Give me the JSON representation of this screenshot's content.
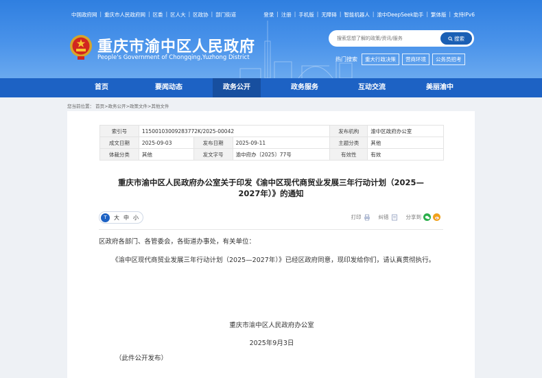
{
  "header": {
    "top_links_left": [
      "中国政府网",
      "重庆市人民政府网",
      "区委",
      "区人大",
      "区政协",
      "部门街道"
    ],
    "top_links_right": [
      "登录",
      "注册",
      "手机版",
      "无障碍",
      "智能机器人",
      "渝中DeepSeek助手",
      "繁体版",
      "支持IPv6"
    ],
    "site_title": "重庆市渝中区人民政府",
    "site_subtitle": "People's Government of Chongqing,Yuzhong District",
    "search": {
      "placeholder": "搜索您想了解的政策/资讯/服务",
      "button_label": "搜索"
    },
    "hot_label": "热门搜索",
    "hot_tags": [
      "重大行政决策",
      "营商环境",
      "公务员招考"
    ]
  },
  "nav": {
    "items": [
      "首页",
      "要闻动态",
      "政务公开",
      "政务服务",
      "互动交流",
      "美丽渝中"
    ],
    "active": "政务公开"
  },
  "breadcrumb": "您当前位置： 首页>政务公开>政策文件>其他文件",
  "meta": {
    "rows": [
      [
        "索引号",
        "11500103009283772K/2025-00042",
        "",
        "",
        "发布机构",
        "渝中区政府办公室"
      ],
      [
        "成文日期",
        "2025-09-03",
        "发布日期",
        "2025-09-11",
        "主题分类",
        "其他"
      ],
      [
        "体裁分类",
        "其他",
        "发文字号",
        "渝中府办〔2025〕77号",
        "有效性",
        "有效"
      ]
    ]
  },
  "article": {
    "title_line1": "重庆市渝中区人民政府办公室关于印发《渝中区现代商贸业发展三年行动计划（2025—",
    "title_line2": "2027年）》的通知",
    "font_size": {
      "large": "大",
      "medium": "中",
      "small": "小"
    },
    "tools": {
      "print": "打印",
      "correct": "纠错",
      "share": "分享到"
    },
    "para1": "区政府各部门、各管委会，各街道办事处，有关单位：",
    "para2": "《渝中区现代商贸业发展三年行动计划（2025—2027年）》已经区政府同意，现印发给你们，请认真贯彻执行。",
    "signature": "重庆市渝中区人民政府办公室",
    "date": "2025年9月3日",
    "note": "（此件公开发布）"
  },
  "colors": {
    "header_blue": "#2f7fe0",
    "nav_blue": "#1d62c4",
    "nav_active": "#174f9f"
  }
}
